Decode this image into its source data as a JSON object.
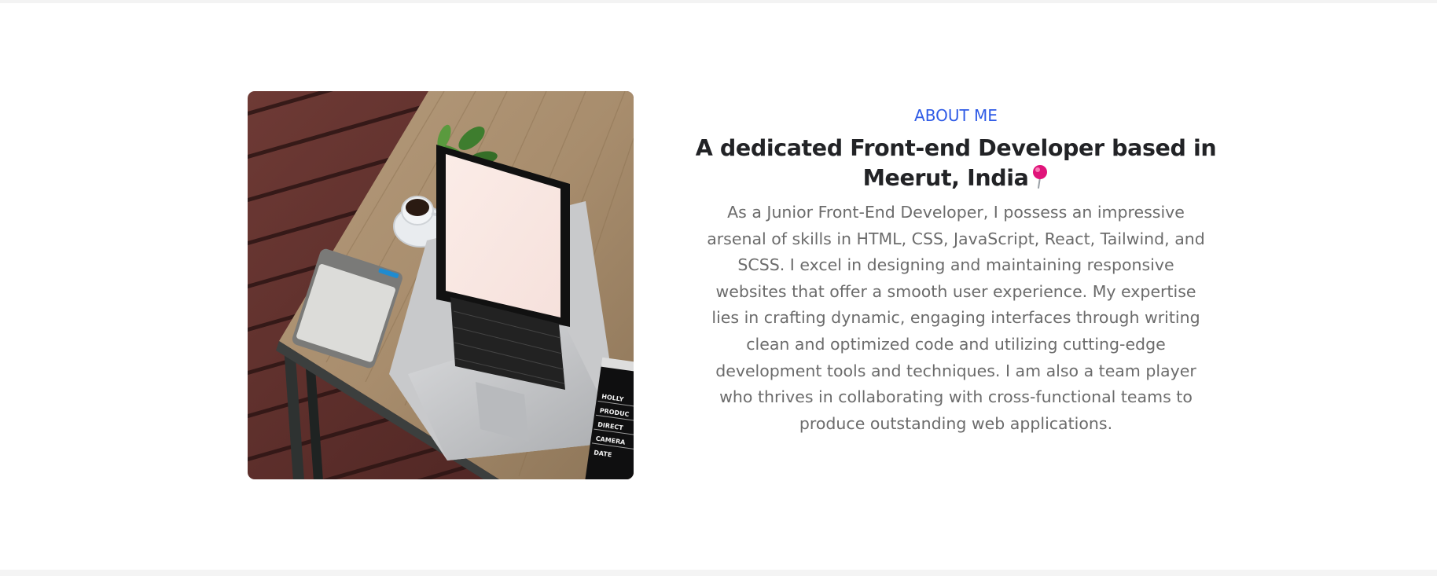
{
  "about": {
    "eyebrow": "ABOUT ME",
    "headline": "A dedicated Front-end Developer based in Meerut, India",
    "bio": "As a Junior Front-End Developer, I possess an impressive arsenal of skills in HTML, CSS, JavaScript, React, Tailwind, and SCSS. I excel in designing and maintaining responsive websites that offer a smooth user experience. My expertise lies in crafting dynamic, engaging interfaces through writing clean and optimized code and utilizing cutting-edge development tools and techniques. I am also a team player who thrives in collaborating with cross-functional teams to produce outstanding web applications.",
    "photo": {
      "slate_lines": [
        "HOLLY",
        "PRODUC",
        "DIRECT",
        "CAMERA",
        "DATE"
      ]
    },
    "icons": {
      "location": "round-pushpin-icon"
    },
    "colors": {
      "accent": "#2f5be6",
      "heading": "#222326",
      "body": "#6b6b6b",
      "pin": "#e0147a"
    }
  }
}
